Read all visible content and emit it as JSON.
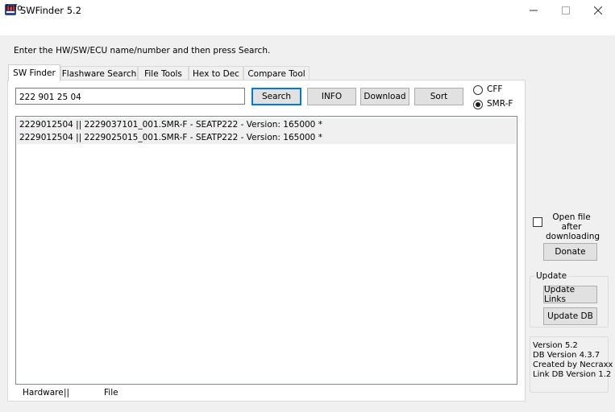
{
  "window": {
    "title": "SWFinder 5.2"
  },
  "menu": {
    "info": "Info"
  },
  "instruction": "Enter the HW/SW/ECU name/number and then press Search.",
  "tabs": [
    {
      "label": "SW Finder",
      "active": true
    },
    {
      "label": "Flashware Search",
      "active": false
    },
    {
      "label": "File Tools",
      "active": false
    },
    {
      "label": "Hex to Dec",
      "active": false
    },
    {
      "label": "Compare Tool",
      "active": false
    }
  ],
  "search": {
    "value": "222 901 25 04"
  },
  "buttons": {
    "search": "Search",
    "info": "INFO",
    "download": "Download",
    "sort": "Sort"
  },
  "format_options": [
    {
      "label": "CFF",
      "selected": false
    },
    {
      "label": "SMR-F",
      "selected": true
    }
  ],
  "results": [
    "2229012504 || 2229037101_001.SMR-F - SEATP222 - Version: 165000 *",
    "2229012504 || 2229025015_001.SMR-F - SEATP222 - Version: 165000 *"
  ],
  "footer": {
    "hardware": "Hardware",
    "separator": "||",
    "file": "File"
  },
  "options": {
    "open_file_label": "Open file after downloading",
    "open_file_checked": false
  },
  "donate_label": "Donate",
  "update": {
    "title": "Update",
    "links_label": "Update Links",
    "db_label": "Update DB"
  },
  "version_info": {
    "version": "Version 5.2",
    "db_version": "DB Version 4.3.7",
    "created_by": "Created by Necraxx",
    "link_db_version": "Link DB Version 1.2"
  },
  "colors": {
    "focus_border": "#0078d7",
    "selection_row": "#f0f0f0"
  }
}
